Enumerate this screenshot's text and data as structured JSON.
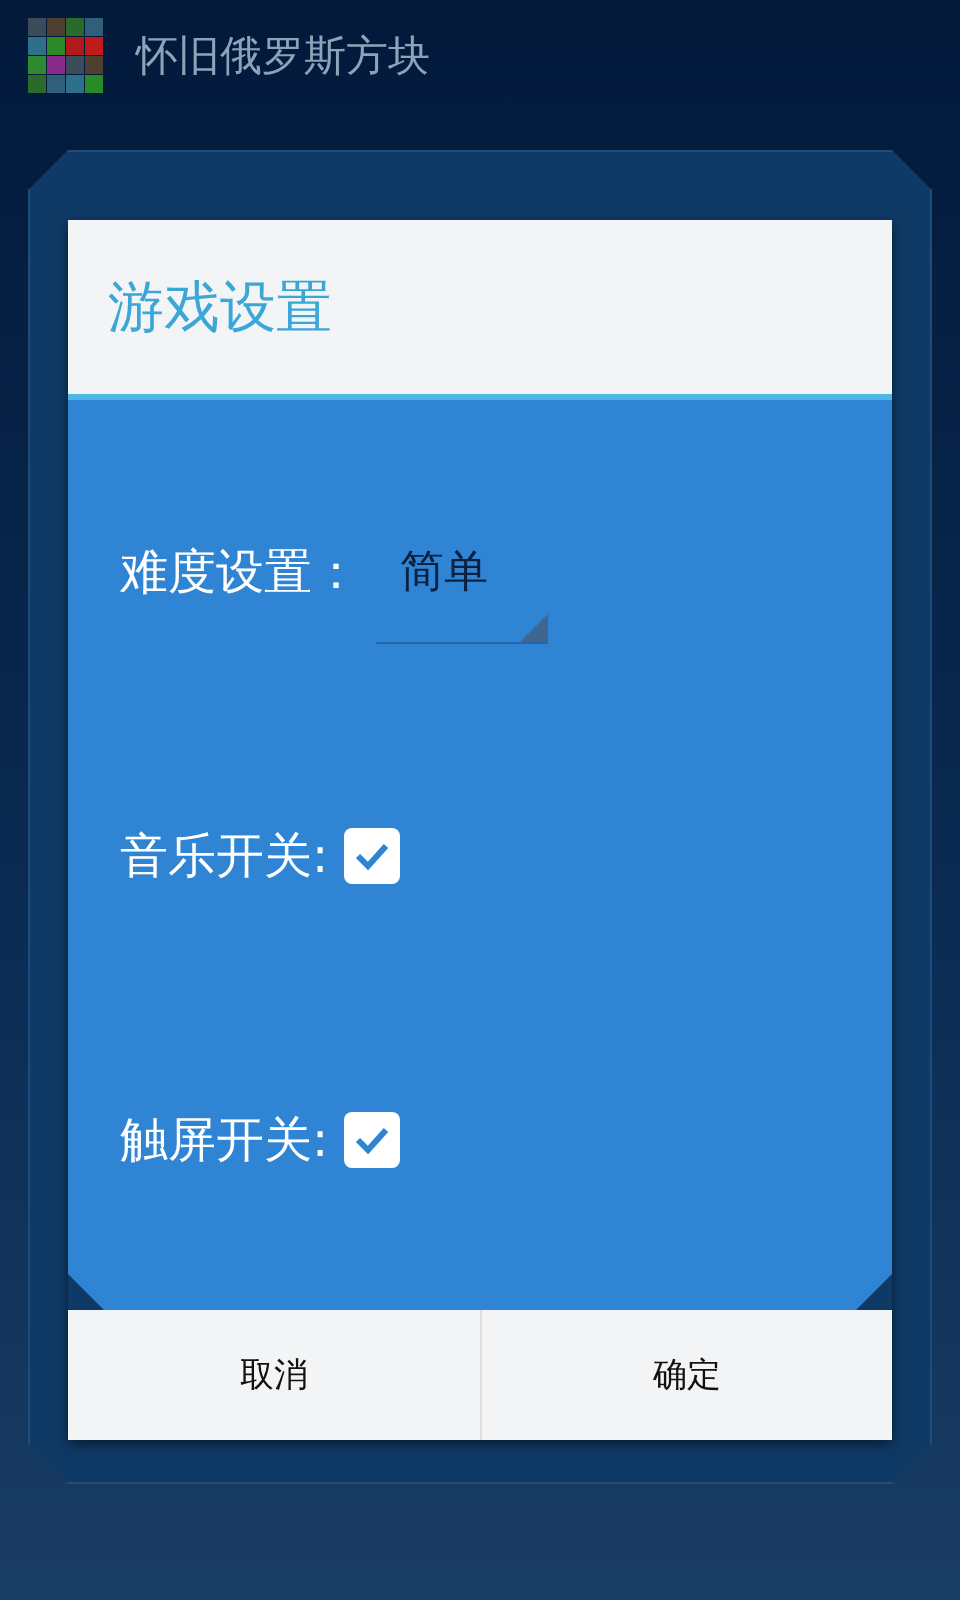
{
  "app_bar": {
    "title": "怀旧俄罗斯方块"
  },
  "dialog": {
    "title": "游戏设置",
    "settings": [
      {
        "kind": "select",
        "label": "难度设置：",
        "value": "简单"
      },
      {
        "kind": "checkbox",
        "label": "音乐开关:",
        "checked": true
      },
      {
        "kind": "checkbox",
        "label": "触屏开关:",
        "checked": true
      }
    ],
    "buttons": [
      "取消",
      "确定"
    ]
  }
}
